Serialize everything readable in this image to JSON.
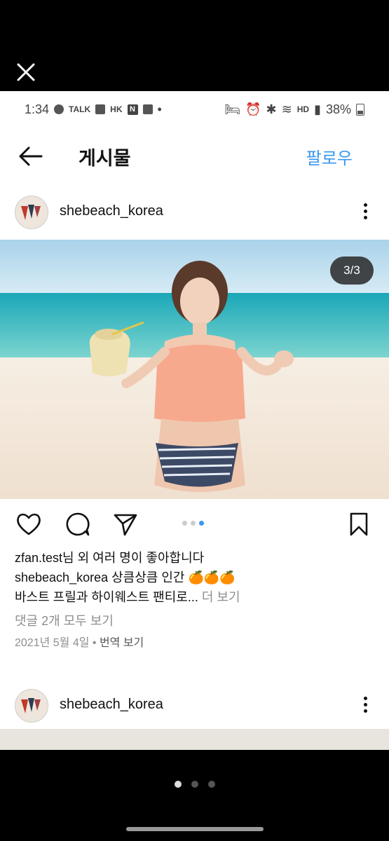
{
  "status_bar": {
    "time": "1:34",
    "left_badges": [
      "TALK",
      "HK",
      "N"
    ],
    "battery": "38%",
    "hd_label": "HD"
  },
  "header": {
    "title": "게시물",
    "follow_label": "팔로우"
  },
  "post": {
    "username": "shebeach_korea",
    "page_indicator": "3/3",
    "likes_text": "zfan.test님 외 여러 명이 좋아합니다",
    "caption_user": "shebeach_korea",
    "caption_text": "상큼상큼 인간 🍊🍊🍊",
    "caption_line2": "바스트 프릴과 하이웨스트 팬티로...",
    "more_label": "더 보기",
    "comments_text": "댓글 2개 모두 보기",
    "date_text": "2021년 5월 4일",
    "translate_label": "번역 보기"
  },
  "next_post": {
    "username": "shebeach_korea"
  },
  "icons": [
    "close-icon",
    "back-arrow-icon",
    "more-vert-icon",
    "heart-icon",
    "comment-icon",
    "share-icon",
    "bookmark-icon"
  ],
  "colors": {
    "accent": "#3897f0",
    "text": "#111111",
    "muted": "#8e8e8e",
    "overlay": "#000000"
  }
}
